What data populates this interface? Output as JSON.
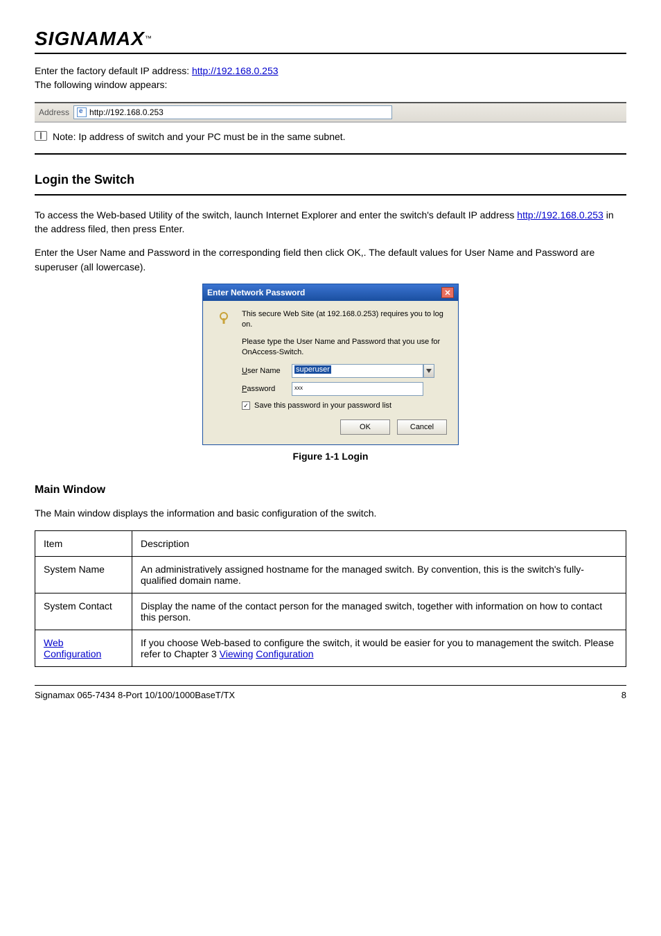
{
  "header": {
    "brand": "SIGNAMAX",
    "tm": "™"
  },
  "intro": {
    "line1_pre": "Enter the factory default IP address: ",
    "url": "http://192.168.0.253",
    "line2": "The following window appears:"
  },
  "addressbar": {
    "label": "Address",
    "url": "http://192.168.0.253"
  },
  "note": {
    "text": "Note: Ip address of switch and your PC must be in the same subnet."
  },
  "section": {
    "title": "Login the Switch",
    "para_a": "To access the Web-based Utility of the switch, launch Internet Explorer and enter the switch's default IP address ",
    "para_url": "http://192.168.0.253",
    "para_b": " in the address filed, then press Enter.",
    "para2": "Enter the User Name and Password in the corresponding field then click OK,. The default values for User Name and Password are superuser (all lowercase)."
  },
  "dialog": {
    "title": "Enter Network Password",
    "msg1": "This secure Web Site (at 192.168.0.253) requires you to log on.",
    "msg2": "Please type the User Name and Password that you use for OnAccess-Switch.",
    "userLabel": "ser Name",
    "passLabel": "assword",
    "userValue": "superuser",
    "passValue": "xxx",
    "saveLabel": "ave this password in your password list",
    "ok": "OK",
    "cancel": "Cancel"
  },
  "figure": {
    "caption": "Figure 1-1  Login"
  },
  "mainWin": {
    "heading": "Main Window",
    "intro": "The Main window displays the information and basic configuration of the switch.",
    "col_item": "Item",
    "col_desc": "Description",
    "r1a": "System Name",
    "r1b": "An administratively assigned hostname for the managed switch. By convention, this is the switch's fully-qualified domain name.",
    "r2a": "System Contact",
    "r2b": "Display the name of the contact person for the managed switch, together with information on how to contact this person.",
    "r3_label1": "Web",
    "r3_label2": "Configuration",
    "r3_b_pre": "If you choose Web-based to configure the switch, it would be easier for you to management the switch. Please refer to Chapter 3 ",
    "r3_link1": "Viewing",
    "r3_b_mid": " ",
    "r3_link2": "Configuration"
  },
  "footer": {
    "left": "Signamax 065-7434 8-Port 10/100/1000BaseT/TX",
    "right": "8"
  }
}
